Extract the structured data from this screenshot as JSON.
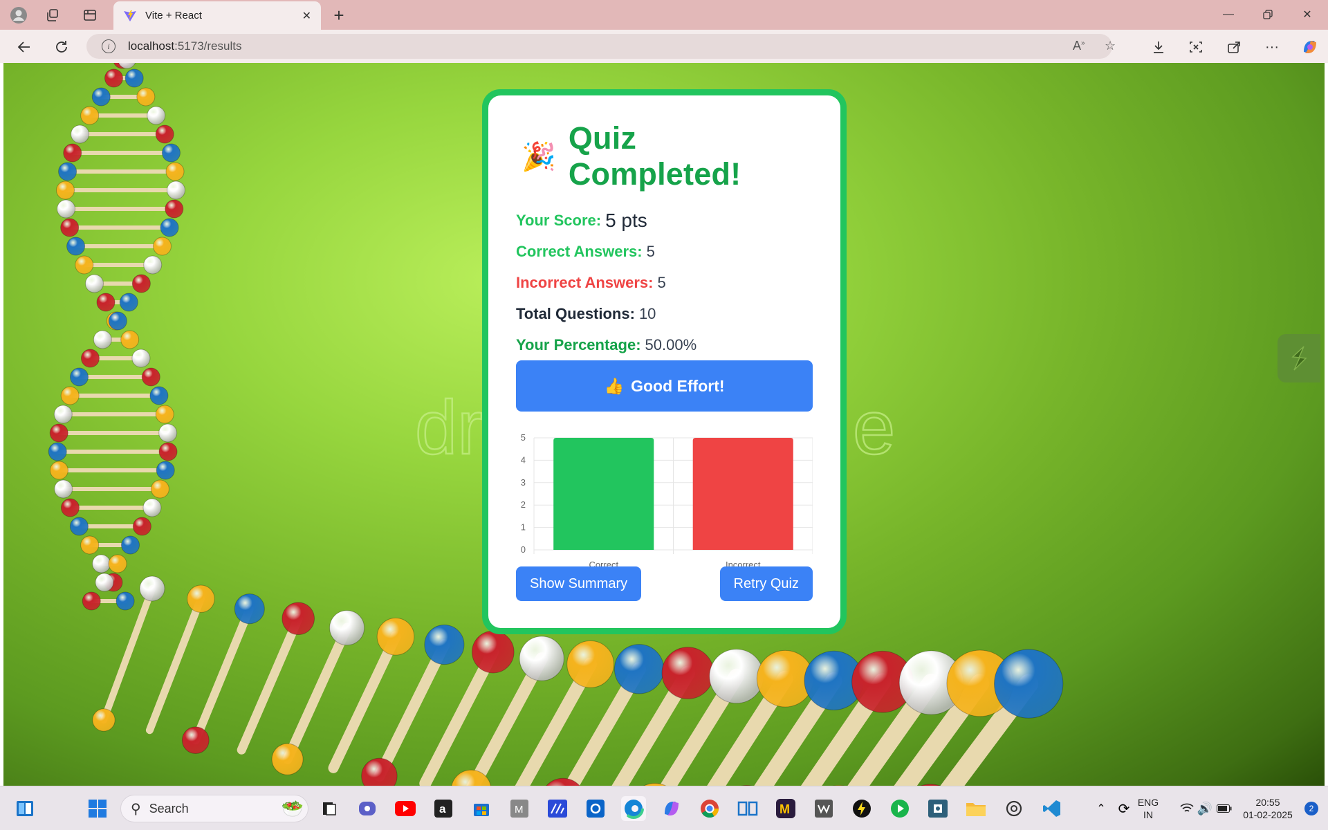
{
  "browser": {
    "tab_title": "Vite + React",
    "url_host": "localhost",
    "url_path": ":5173/results"
  },
  "card": {
    "title_emoji": "🎉",
    "title": "Quiz Completed!",
    "stats": {
      "score_label": "Your Score:",
      "score_value": "5 pts",
      "correct_label": "Correct Answers:",
      "correct_value": "5",
      "incorrect_label": "Incorrect Answers:",
      "incorrect_value": "5",
      "total_label": "Total Questions:",
      "total_value": "10",
      "percentage_label": "Your Percentage:",
      "percentage_value": "50.00%"
    },
    "feedback_emoji": "👍",
    "feedback_label": "Good Effort!",
    "show_summary_label": "Show Summary",
    "retry_label": "Retry Quiz"
  },
  "chart_data": {
    "type": "bar",
    "categories": [
      "Correct",
      "Incorrect"
    ],
    "values": [
      5,
      5
    ],
    "colors": [
      "#22c55e",
      "#ef4444"
    ],
    "yticks": [
      0,
      1,
      2,
      3,
      4,
      5
    ],
    "ylim": [
      0,
      5
    ],
    "grid": true
  },
  "taskbar": {
    "search_placeholder": "Search",
    "lang_top": "ENG",
    "lang_bottom": "IN",
    "time": "20:55",
    "date": "01-02-2025",
    "notification_count": "2"
  },
  "colors": {
    "accent_green": "#22c55e",
    "accent_red": "#ef4444",
    "accent_blue": "#3b82f6"
  }
}
